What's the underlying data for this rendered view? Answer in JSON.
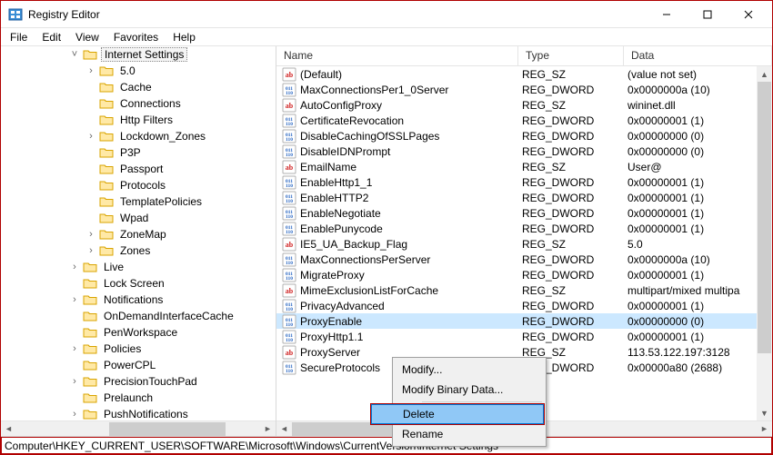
{
  "window": {
    "title": "Registry Editor"
  },
  "menu": {
    "items": [
      "File",
      "Edit",
      "View",
      "Favorites",
      "Help"
    ]
  },
  "tree": {
    "selected_label": "Internet Settings",
    "items": [
      {
        "depth": 4,
        "twisty": "v",
        "label": "Internet Settings",
        "selected": true
      },
      {
        "depth": 5,
        "twisty": ">",
        "label": "5.0"
      },
      {
        "depth": 5,
        "twisty": "",
        "label": "Cache"
      },
      {
        "depth": 5,
        "twisty": "",
        "label": "Connections"
      },
      {
        "depth": 5,
        "twisty": "",
        "label": "Http Filters"
      },
      {
        "depth": 5,
        "twisty": ">",
        "label": "Lockdown_Zones"
      },
      {
        "depth": 5,
        "twisty": "",
        "label": "P3P"
      },
      {
        "depth": 5,
        "twisty": "",
        "label": "Passport"
      },
      {
        "depth": 5,
        "twisty": "",
        "label": "Protocols"
      },
      {
        "depth": 5,
        "twisty": "",
        "label": "TemplatePolicies"
      },
      {
        "depth": 5,
        "twisty": "",
        "label": "Wpad"
      },
      {
        "depth": 5,
        "twisty": ">",
        "label": "ZoneMap"
      },
      {
        "depth": 5,
        "twisty": ">",
        "label": "Zones"
      },
      {
        "depth": 4,
        "twisty": ">",
        "label": "Live"
      },
      {
        "depth": 4,
        "twisty": "",
        "label": "Lock Screen"
      },
      {
        "depth": 4,
        "twisty": ">",
        "label": "Notifications"
      },
      {
        "depth": 4,
        "twisty": "",
        "label": "OnDemandInterfaceCache"
      },
      {
        "depth": 4,
        "twisty": "",
        "label": "PenWorkspace"
      },
      {
        "depth": 4,
        "twisty": ">",
        "label": "Policies"
      },
      {
        "depth": 4,
        "twisty": "",
        "label": "PowerCPL"
      },
      {
        "depth": 4,
        "twisty": ">",
        "label": "PrecisionTouchPad"
      },
      {
        "depth": 4,
        "twisty": "",
        "label": "Prelaunch"
      },
      {
        "depth": 4,
        "twisty": ">",
        "label": "PushNotifications"
      }
    ]
  },
  "list": {
    "headers": {
      "name": "Name",
      "type": "Type",
      "data": "Data"
    },
    "rows": [
      {
        "icon": "sz",
        "name": "(Default)",
        "type": "REG_SZ",
        "data": "(value not set)"
      },
      {
        "icon": "dw",
        "name": "MaxConnectionsPer1_0Server",
        "type": "REG_DWORD",
        "data": "0x0000000a (10)"
      },
      {
        "icon": "sz",
        "name": "AutoConfigProxy",
        "type": "REG_SZ",
        "data": "wininet.dll"
      },
      {
        "icon": "dw",
        "name": "CertificateRevocation",
        "type": "REG_DWORD",
        "data": "0x00000001 (1)"
      },
      {
        "icon": "dw",
        "name": "DisableCachingOfSSLPages",
        "type": "REG_DWORD",
        "data": "0x00000000 (0)"
      },
      {
        "icon": "dw",
        "name": "DisableIDNPrompt",
        "type": "REG_DWORD",
        "data": "0x00000000 (0)"
      },
      {
        "icon": "sz",
        "name": "EmailName",
        "type": "REG_SZ",
        "data": "User@"
      },
      {
        "icon": "dw",
        "name": "EnableHttp1_1",
        "type": "REG_DWORD",
        "data": "0x00000001 (1)"
      },
      {
        "icon": "dw",
        "name": "EnableHTTP2",
        "type": "REG_DWORD",
        "data": "0x00000001 (1)"
      },
      {
        "icon": "dw",
        "name": "EnableNegotiate",
        "type": "REG_DWORD",
        "data": "0x00000001 (1)"
      },
      {
        "icon": "dw",
        "name": "EnablePunycode",
        "type": "REG_DWORD",
        "data": "0x00000001 (1)"
      },
      {
        "icon": "sz",
        "name": "IE5_UA_Backup_Flag",
        "type": "REG_SZ",
        "data": "5.0"
      },
      {
        "icon": "dw",
        "name": "MaxConnectionsPerServer",
        "type": "REG_DWORD",
        "data": "0x0000000a (10)"
      },
      {
        "icon": "dw",
        "name": "MigrateProxy",
        "type": "REG_DWORD",
        "data": "0x00000001 (1)"
      },
      {
        "icon": "sz",
        "name": "MimeExclusionListForCache",
        "type": "REG_SZ",
        "data": "multipart/mixed multipa"
      },
      {
        "icon": "dw",
        "name": "PrivacyAdvanced",
        "type": "REG_DWORD",
        "data": "0x00000001 (1)"
      },
      {
        "icon": "dw",
        "name": "ProxyEnable",
        "type": "REG_DWORD",
        "data": "0x00000000 (0)",
        "selected": true,
        "type_masked": "DWORD"
      },
      {
        "icon": "dw",
        "name": "ProxyHttp1.1",
        "type": "REG_DWORD",
        "data": "0x00000001 (1)",
        "type_masked": "DWORD"
      },
      {
        "icon": "sz",
        "name": "ProxyServer",
        "type": "REG_SZ",
        "data": "113.53.122.197:3128",
        "type_masked": "Z"
      },
      {
        "icon": "dw",
        "name": "SecureProtocols",
        "type": "REG_DWORD",
        "data": "0x00000a80 (2688)",
        "type_masked": "DWORD"
      }
    ]
  },
  "context_menu": {
    "items": [
      {
        "label": "Modify..."
      },
      {
        "label": "Modify Binary Data..."
      },
      {
        "sep": true
      },
      {
        "label": "Delete",
        "highlight": true
      },
      {
        "label": "Rename"
      }
    ]
  },
  "statusbar": {
    "path": "Computer\\HKEY_CURRENT_USER\\SOFTWARE\\Microsoft\\Windows\\CurrentVersion\\Internet Settings"
  },
  "icons": {
    "twisty_down": "v",
    "twisty_right": ">"
  }
}
